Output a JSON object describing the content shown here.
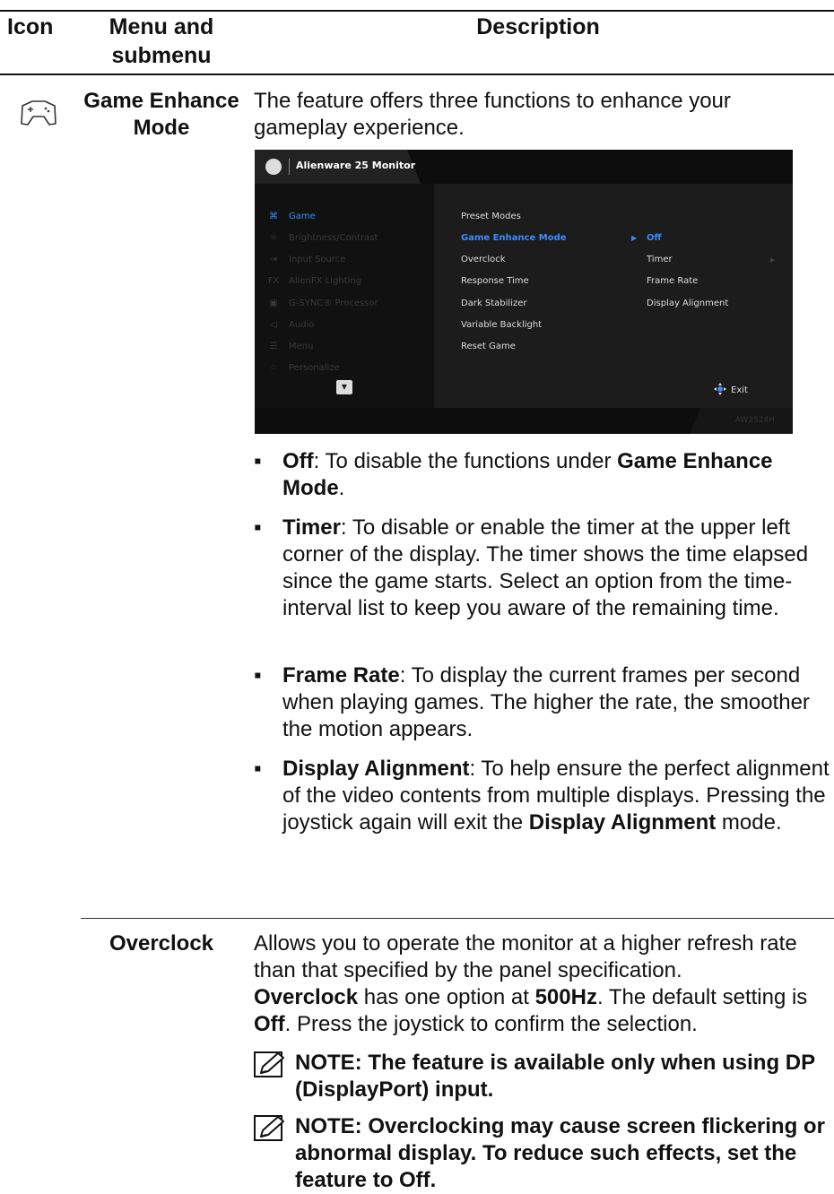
{
  "table": {
    "headers": {
      "icon": "Icon",
      "menu": "Menu and submenu",
      "description": "Description"
    }
  },
  "game_enhance": {
    "icon": "gamepad-icon",
    "name": "Game Enhance Mode",
    "intro": "The feature offers three functions to enhance your gameplay experience.",
    "bullets": [
      {
        "term": "Off",
        "text_a": ": To disable the functions under ",
        "term2": "Game Enhance Mode",
        "text_b": "."
      },
      {
        "term": "Timer",
        "text_a": ": To disable or enable the timer at the upper left corner of the display. The timer shows the time elapsed since the game starts. Select an option from the time-interval list to keep you aware of the remaining time."
      },
      {
        "term": "Frame Rate",
        "text_a": ": To display the current frames per second when playing games. The higher the rate, the smoother the motion appears."
      },
      {
        "term": "Display Alignment",
        "text_a": ": To help ensure the perfect alignment of the video contents from multiple displays. Pressing the joystick again will exit the ",
        "term2": "Display Alignment",
        "text_b": " mode."
      }
    ],
    "bullet_glyph": "▪"
  },
  "osd": {
    "title": "Alienware 25 Monitor",
    "model": "AW2524H",
    "left_menu": [
      {
        "label": "Game",
        "icon": "gamepad-icon",
        "glyph": "⌘"
      },
      {
        "label": "Brightness/Contrast",
        "icon": "brightness-icon",
        "glyph": "☼"
      },
      {
        "label": "Input Source",
        "icon": "input-icon",
        "glyph": "⇥"
      },
      {
        "label": "AlienFX Lighting",
        "icon": "fx-icon",
        "glyph": "FX"
      },
      {
        "label": "G-SYNC® Processor",
        "icon": "chip-icon",
        "glyph": "▣"
      },
      {
        "label": "Audio",
        "icon": "speaker-icon",
        "glyph": "◁"
      },
      {
        "label": "Menu",
        "icon": "menu-icon",
        "glyph": "☰"
      },
      {
        "label": "Personalize",
        "icon": "star-icon",
        "glyph": "☆"
      }
    ],
    "game_menu": [
      "Preset Modes",
      "Game Enhance Mode",
      "Overclock",
      "Response Time",
      "Dark Stabilizer",
      "Variable Backlight",
      "Reset Game"
    ],
    "submenu": [
      "Off",
      "Timer",
      "Frame Rate",
      "Display Alignment"
    ],
    "exit_label": "Exit",
    "scroll_glyph": "▼"
  },
  "overclock": {
    "name": "Overclock",
    "p1": "Allows you to operate the monitor at a higher refresh rate than that specified by the panel specification.",
    "p2_term": "Overclock",
    "p2_a": " has one option at ",
    "p2_val": "500Hz",
    "p2_b": ". The default setting is ",
    "p2_off": "Off",
    "p2_c": ". Press the joystick to confirm the selection.",
    "notes": [
      "NOTE: The feature is available only when using DP (DisplayPort) input.",
      "NOTE: Overclocking may cause screen flickering or abnormal display. To reduce such effects, set the feature to Off."
    ],
    "note_icon": "pencil-note-icon"
  }
}
